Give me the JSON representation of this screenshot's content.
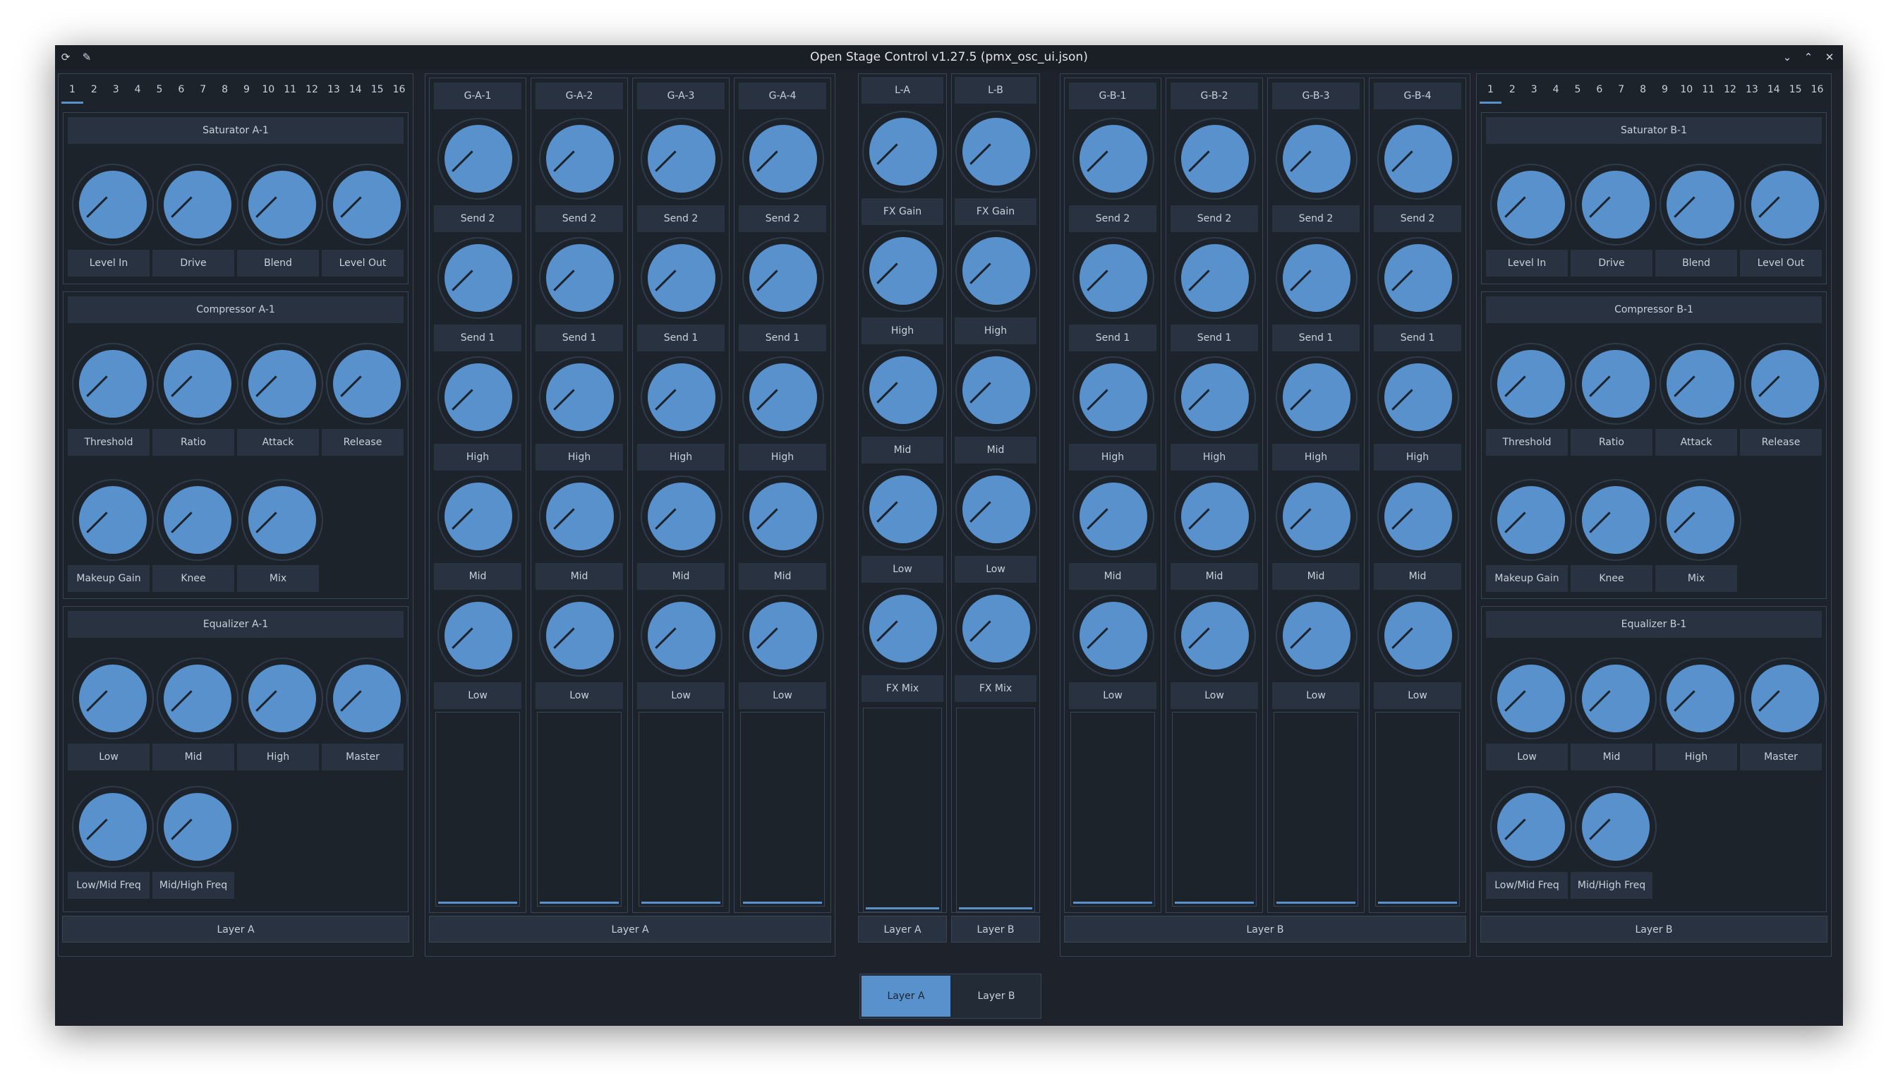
{
  "window": {
    "title": "Open Stage Control v1.27.5 (pmx_osc_ui.json)"
  },
  "left_panel": {
    "tabs": [
      "1",
      "2",
      "3",
      "4",
      "5",
      "6",
      "7",
      "8",
      "9",
      "10",
      "11",
      "12",
      "13",
      "14",
      "15",
      "16"
    ],
    "active_tab": 0,
    "sections": [
      {
        "title": "Saturator A-1",
        "knobs": [
          "Level In",
          "Drive",
          "Blend",
          "Level Out"
        ]
      },
      {
        "title": "Compressor A-1",
        "knobs": [
          "Threshold",
          "Ratio",
          "Attack",
          "Release",
          "Makeup Gain",
          "Knee",
          "Mix"
        ]
      },
      {
        "title": "Equalizer A-1",
        "knobs": [
          "Low",
          "Mid",
          "High",
          "Master",
          "Low/Mid Freq",
          "Mid/High Freq"
        ]
      }
    ],
    "footer": "Layer A"
  },
  "right_panel": {
    "tabs": [
      "1",
      "2",
      "3",
      "4",
      "5",
      "6",
      "7",
      "8",
      "9",
      "10",
      "11",
      "12",
      "13",
      "14",
      "15",
      "16"
    ],
    "active_tab": 0,
    "sections": [
      {
        "title": "Saturator B-1",
        "knobs": [
          "Level In",
          "Drive",
          "Blend",
          "Level Out"
        ]
      },
      {
        "title": "Compressor B-1",
        "knobs": [
          "Threshold",
          "Ratio",
          "Attack",
          "Release",
          "Makeup Gain",
          "Knee",
          "Mix"
        ]
      },
      {
        "title": "Equalizer B-1",
        "knobs": [
          "Low",
          "Mid",
          "High",
          "Master",
          "Low/Mid Freq",
          "Mid/High Freq"
        ]
      }
    ],
    "footer": "Layer B"
  },
  "group_a": {
    "strips": [
      "G-A-1",
      "G-A-2",
      "G-A-3",
      "G-A-4"
    ],
    "knobs": [
      "Send 2",
      "Send 1",
      "High",
      "Mid",
      "Low"
    ],
    "fader_value": 0.0,
    "footer": "Layer A"
  },
  "group_b": {
    "strips": [
      "G-B-1",
      "G-B-2",
      "G-B-3",
      "G-B-4"
    ],
    "knobs": [
      "Send 2",
      "Send 1",
      "High",
      "Mid",
      "Low"
    ],
    "fader_value": 0.0,
    "footer": "Layer B"
  },
  "layers": {
    "strips": [
      {
        "title": "L-A",
        "footer": "Layer A"
      },
      {
        "title": "L-B",
        "footer": "Layer B"
      }
    ],
    "knobs": [
      "FX Gain",
      "High",
      "Mid",
      "Low",
      "FX Mix"
    ],
    "fader_value": 0.0
  },
  "layer_switch": {
    "options": [
      "Layer A",
      "Layer B"
    ],
    "selected": "Layer A"
  },
  "colors": {
    "accent": "#5891cc",
    "background": "#1e232b",
    "widget": "#283241",
    "border": "#394557"
  },
  "icons": {
    "app": "refresh-icon",
    "pin": "pin-icon",
    "minimize": "chevron-down-icon",
    "maximize": "chevron-up-icon",
    "close": "close-icon"
  }
}
